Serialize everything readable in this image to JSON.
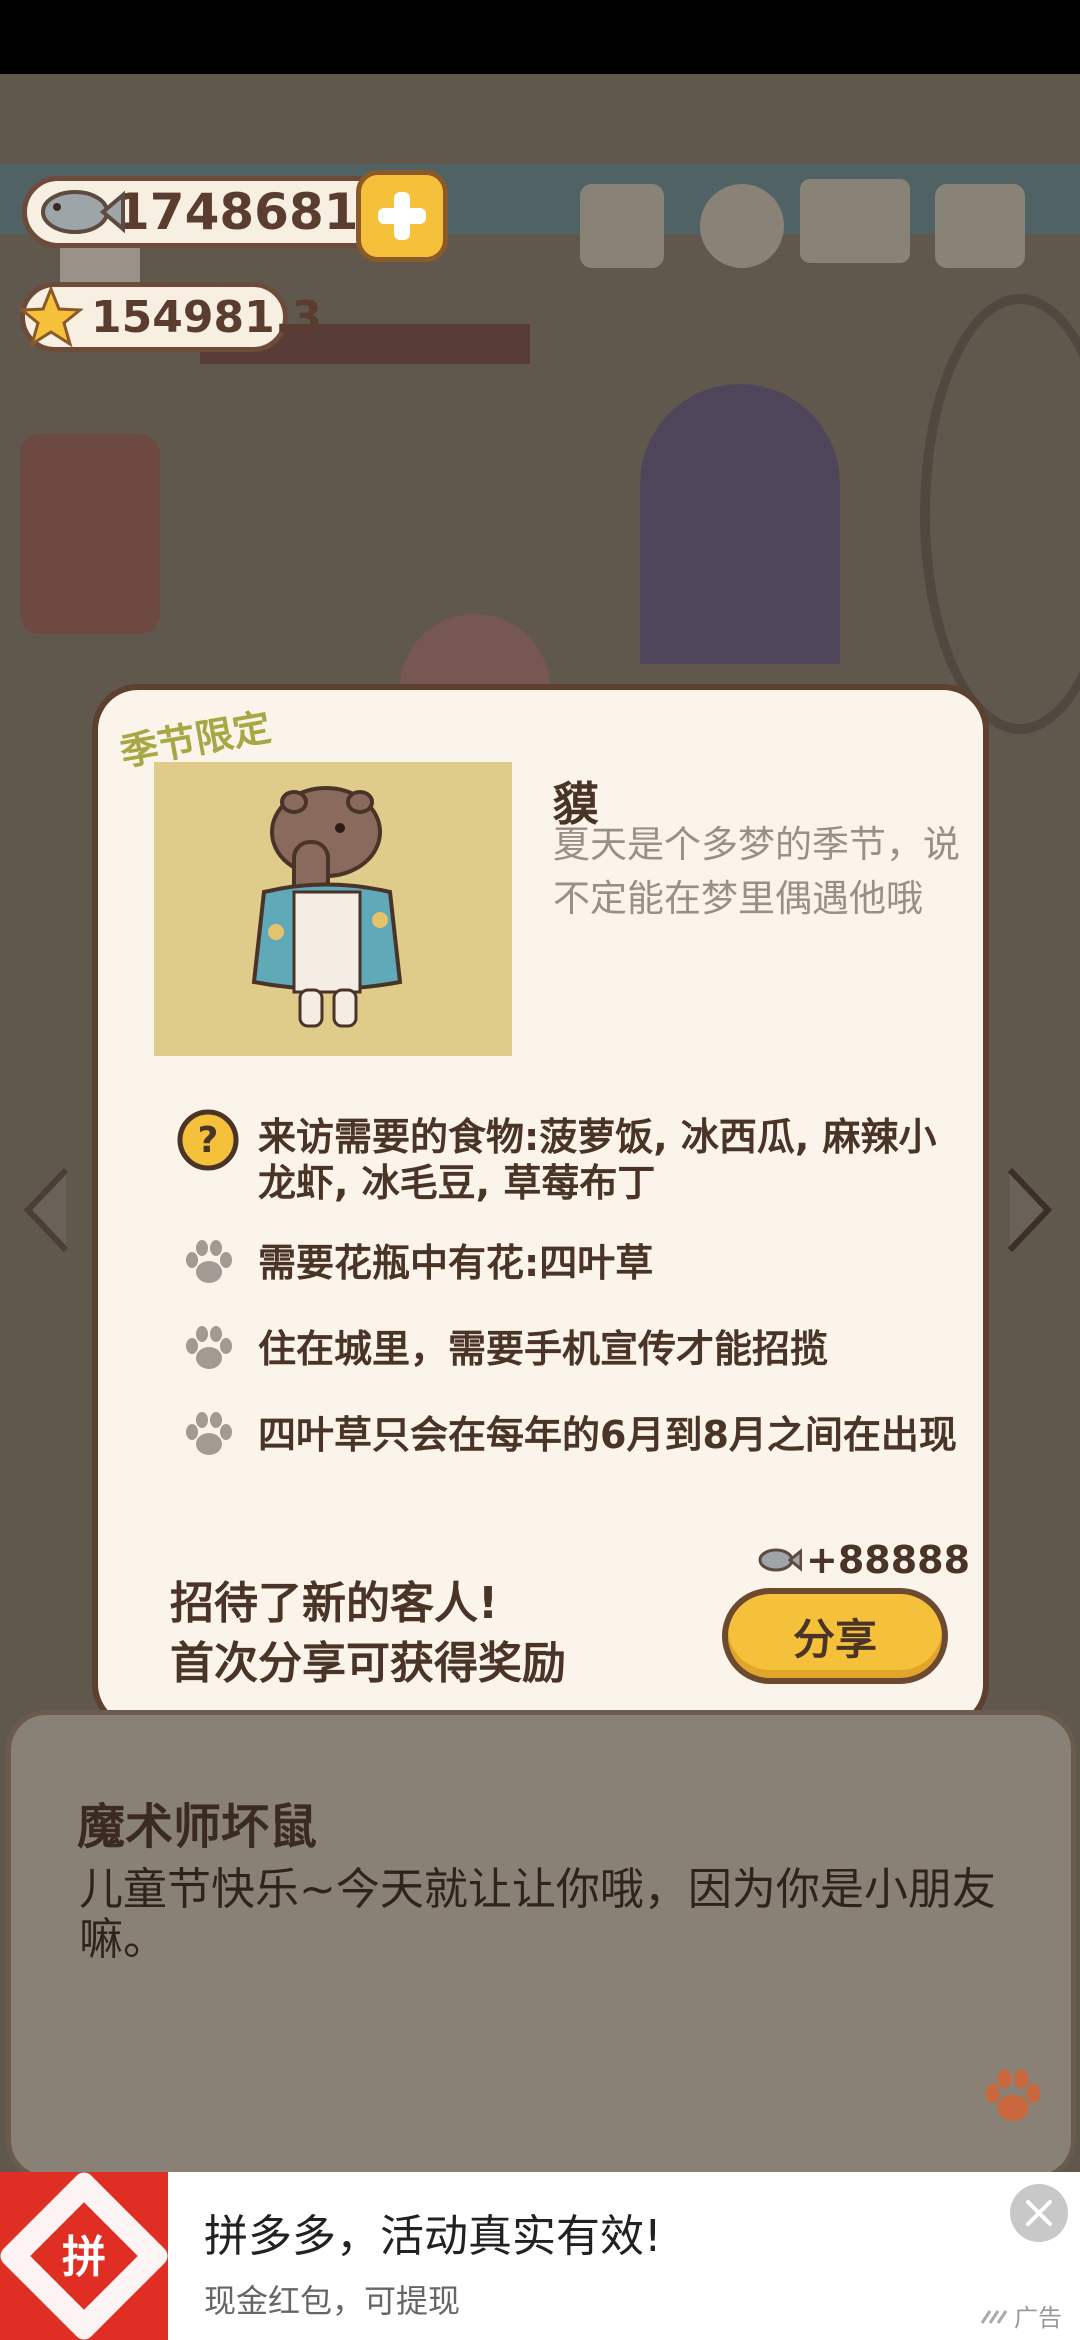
{
  "currency": {
    "fish": "17486814",
    "stars": "154981.3"
  },
  "card": {
    "season_tag": "季节限定",
    "animal_name": "貘",
    "animal_desc": "夏天是个多梦的季节，说不定能在梦里偶遇他哦",
    "requirements": [
      {
        "icon": "question-icon",
        "text": "来访需要的食物:菠萝饭, 冰西瓜, 麻辣小龙虾, 冰毛豆, 草莓布丁"
      },
      {
        "icon": "paw-icon",
        "text": "需要花瓶中有花:四叶草"
      },
      {
        "icon": "paw-icon",
        "text": "住在城里，需要手机宣传才能招揽"
      },
      {
        "icon": "paw-icon",
        "text": "四叶草只会在每年的6月到8月之间在出现"
      }
    ],
    "reward": "+88888",
    "new_guest_line1": "招待了新的客人!",
    "new_guest_line2": "首次分享可获得奖励",
    "share_label": "分享"
  },
  "dialog": {
    "speaker": "魔术师坏鼠",
    "text": "儿童节快乐~今天就让让你哦，因为你是小朋友嘛。"
  },
  "ad": {
    "title": "拼多多，活动真实有效!",
    "subtitle": "现金红包，可提现",
    "label": "广告",
    "logo_text": "拼"
  },
  "colors": {
    "accent_yellow": "#f5c03a",
    "card_bg": "#fbf4ea",
    "border_brown": "#5d4030",
    "season_tag": "#a8a745",
    "ad_red": "#e02e24"
  }
}
